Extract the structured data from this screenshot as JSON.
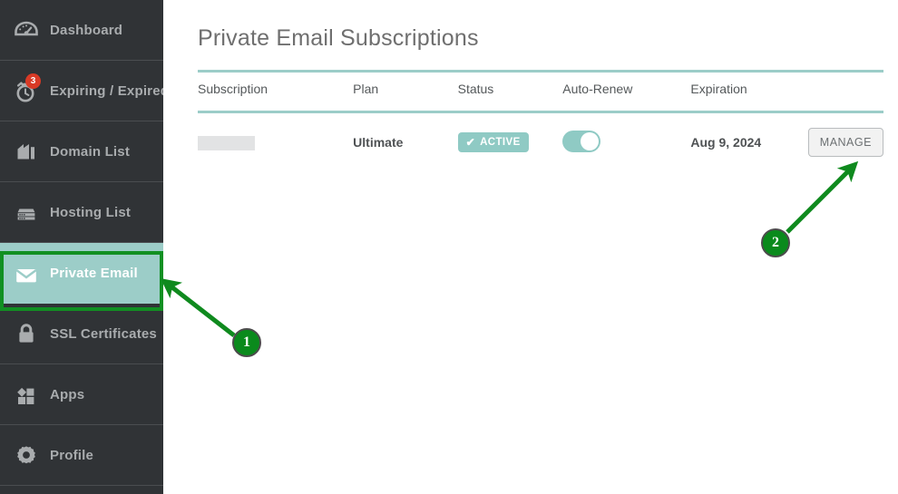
{
  "sidebar": {
    "items": [
      {
        "label": "Dashboard",
        "icon": "speedometer-icon",
        "active": false,
        "badge": null
      },
      {
        "label": "Expiring / Expired",
        "icon": "stopwatch-icon",
        "active": false,
        "badge": "3"
      },
      {
        "label": "Domain List",
        "icon": "house-icon",
        "active": false,
        "badge": null
      },
      {
        "label": "Hosting List",
        "icon": "server-icon",
        "active": false,
        "badge": null
      },
      {
        "label": "Private Email",
        "icon": "envelope-icon",
        "active": true,
        "badge": null
      },
      {
        "label": "SSL Certificates",
        "icon": "lock-icon",
        "active": false,
        "badge": null
      },
      {
        "label": "Apps",
        "icon": "apps-grid-icon",
        "active": false,
        "badge": null
      },
      {
        "label": "Profile",
        "icon": "gear-icon",
        "active": false,
        "badge": null
      }
    ]
  },
  "main": {
    "title": "Private Email Subscriptions",
    "table": {
      "headers": [
        "Subscription",
        "Plan",
        "Status",
        "Auto-Renew",
        "Expiration",
        ""
      ],
      "rows": [
        {
          "subscription": "",
          "subscription_redacted": true,
          "plan": "Ultimate",
          "status": "ACTIVE",
          "status_check": "✔",
          "auto_renew": true,
          "expiration": "Aug 9, 2024",
          "action": "MANAGE"
        }
      ]
    }
  },
  "annotations": {
    "markers": [
      {
        "id": "1",
        "label": "1",
        "target": "sidebar-item-private-email"
      },
      {
        "id": "2",
        "label": "2",
        "target": "manage-button"
      }
    ]
  },
  "colors": {
    "sidebar_bg": "#303336",
    "accent_teal": "#8fcac4",
    "annotation_green": "#0a8a1c",
    "badge_red": "#d93a26"
  }
}
